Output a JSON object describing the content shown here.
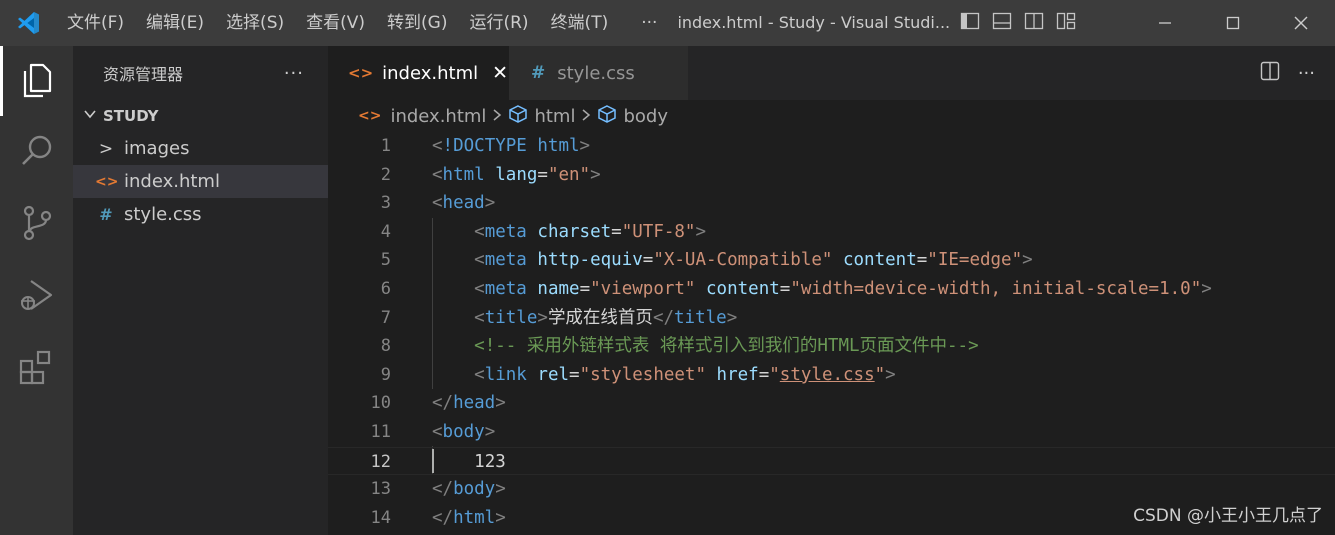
{
  "titlebar": {
    "menu": [
      "文件(F)",
      "编辑(E)",
      "选择(S)",
      "查看(V)",
      "转到(G)",
      "运行(R)",
      "终端(T)"
    ],
    "more": "···",
    "title": "index.html - Study - Visual Studi..."
  },
  "sidebar": {
    "title": "资源管理器",
    "more": "···",
    "folder": "STUDY",
    "items": [
      {
        "label": "images",
        "icon": "chevron-right-icon",
        "glyph": ">"
      },
      {
        "label": "index.html",
        "icon": "html-file-icon",
        "glyph": "<>"
      },
      {
        "label": "style.css",
        "icon": "css-file-icon",
        "glyph": "#"
      }
    ]
  },
  "tabs": [
    {
      "label": "index.html",
      "icon_glyph": "<>",
      "close": "✕"
    },
    {
      "label": "style.css",
      "icon_glyph": "#"
    }
  ],
  "tab_actions": {
    "more": "···"
  },
  "breadcrumb": [
    "index.html",
    "html",
    "body"
  ],
  "editor": {
    "current_line": 12,
    "lines": [
      {
        "n": "1",
        "indent": "",
        "tokens": [
          [
            "punc",
            "<"
          ],
          [
            "tag",
            "!DOCTYPE"
          ],
          [
            "txt",
            " "
          ],
          [
            "tag",
            "html"
          ],
          [
            "punc",
            ">"
          ]
        ]
      },
      {
        "n": "2",
        "indent": "",
        "tokens": [
          [
            "punc",
            "<"
          ],
          [
            "tag",
            "html"
          ],
          [
            "txt",
            " "
          ],
          [
            "attr",
            "lang"
          ],
          [
            "txt",
            "="
          ],
          [
            "str",
            "\"en\""
          ],
          [
            "punc",
            ">"
          ]
        ]
      },
      {
        "n": "3",
        "indent": "",
        "tokens": [
          [
            "punc",
            "<"
          ],
          [
            "tag",
            "head"
          ],
          [
            "punc",
            ">"
          ]
        ]
      },
      {
        "n": "4",
        "indent": "    ",
        "tokens": [
          [
            "punc",
            "<"
          ],
          [
            "tag",
            "meta"
          ],
          [
            "txt",
            " "
          ],
          [
            "attr",
            "charset"
          ],
          [
            "txt",
            "="
          ],
          [
            "str",
            "\"UTF-8\""
          ],
          [
            "punc",
            ">"
          ]
        ]
      },
      {
        "n": "5",
        "indent": "    ",
        "tokens": [
          [
            "punc",
            "<"
          ],
          [
            "tag",
            "meta"
          ],
          [
            "txt",
            " "
          ],
          [
            "attr",
            "http-equiv"
          ],
          [
            "txt",
            "="
          ],
          [
            "str",
            "\"X-UA-Compatible\""
          ],
          [
            "txt",
            " "
          ],
          [
            "attr",
            "content"
          ],
          [
            "txt",
            "="
          ],
          [
            "str",
            "\"IE=edge\""
          ],
          [
            "punc",
            ">"
          ]
        ]
      },
      {
        "n": "6",
        "indent": "    ",
        "tokens": [
          [
            "punc",
            "<"
          ],
          [
            "tag",
            "meta"
          ],
          [
            "txt",
            " "
          ],
          [
            "attr",
            "name"
          ],
          [
            "txt",
            "="
          ],
          [
            "str",
            "\"viewport\""
          ],
          [
            "txt",
            " "
          ],
          [
            "attr",
            "content"
          ],
          [
            "txt",
            "="
          ],
          [
            "str",
            "\"width=device-width, initial-scale=1.0\""
          ],
          [
            "punc",
            ">"
          ]
        ]
      },
      {
        "n": "7",
        "indent": "    ",
        "tokens": [
          [
            "punc",
            "<"
          ],
          [
            "tag",
            "title"
          ],
          [
            "punc",
            ">"
          ],
          [
            "txt",
            "学成在线首页"
          ],
          [
            "punc",
            "</"
          ],
          [
            "tag",
            "title"
          ],
          [
            "punc",
            ">"
          ]
        ]
      },
      {
        "n": "8",
        "indent": "    ",
        "tokens": [
          [
            "cmt",
            "<!-- 采用外链样式表 将样式引入到我们的HTML页面文件中-->"
          ]
        ]
      },
      {
        "n": "9",
        "indent": "    ",
        "tokens": [
          [
            "punc",
            "<"
          ],
          [
            "tag",
            "link"
          ],
          [
            "txt",
            " "
          ],
          [
            "attr",
            "rel"
          ],
          [
            "txt",
            "="
          ],
          [
            "str",
            "\"stylesheet\""
          ],
          [
            "txt",
            " "
          ],
          [
            "attr",
            "href"
          ],
          [
            "txt",
            "="
          ],
          [
            "str",
            "\""
          ],
          [
            "link",
            "style.css"
          ],
          [
            "str",
            "\""
          ],
          [
            "punc",
            ">"
          ]
        ]
      },
      {
        "n": "10",
        "indent": "",
        "tokens": [
          [
            "punc",
            "</"
          ],
          [
            "tag",
            "head"
          ],
          [
            "punc",
            ">"
          ]
        ]
      },
      {
        "n": "11",
        "indent": "",
        "tokens": [
          [
            "punc",
            "<"
          ],
          [
            "tag",
            "body"
          ],
          [
            "punc",
            ">"
          ]
        ]
      },
      {
        "n": "12",
        "indent": "    ",
        "tokens": [
          [
            "txt",
            "123"
          ]
        ]
      },
      {
        "n": "13",
        "indent": "",
        "tokens": [
          [
            "punc",
            "</"
          ],
          [
            "tag",
            "body"
          ],
          [
            "punc",
            ">"
          ]
        ]
      },
      {
        "n": "14",
        "indent": "",
        "tokens": [
          [
            "punc",
            "</"
          ],
          [
            "tag",
            "html"
          ],
          [
            "punc",
            ">"
          ]
        ]
      }
    ]
  },
  "watermark": "CSDN @小王小王几点了",
  "colors": {
    "accent": "#0078d4",
    "html_icon": "#e37933",
    "css_icon": "#519aba"
  }
}
